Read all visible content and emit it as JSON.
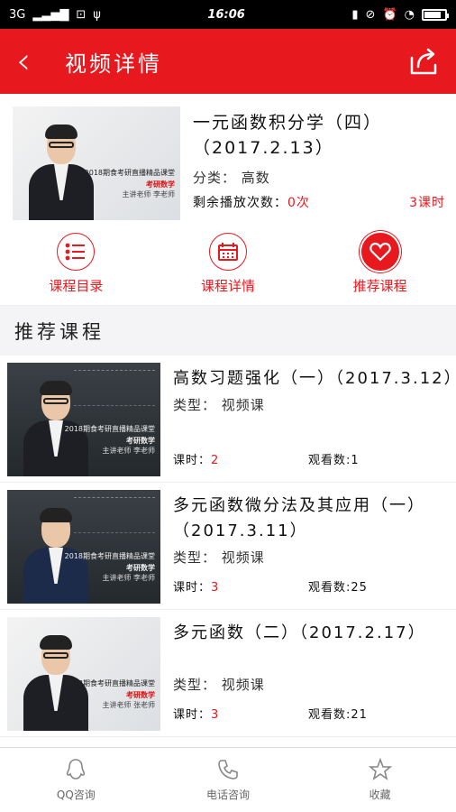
{
  "status_bar": {
    "network": "3G",
    "time": "16:06"
  },
  "appbar": {
    "title": "视频详情",
    "back_icon": "chevron-left-icon",
    "share_icon": "share-icon"
  },
  "course": {
    "title": "一元函数积分学（四）（2017.2.13）",
    "category": "分类：  高数",
    "remaining": "剩余播放次数：",
    "remaining_value": "0次",
    "hours": "3课时",
    "thumb": {
      "cap1": "2018期食考研直播精品课堂",
      "cap2": "考研数学",
      "cap3": "主讲老师 李老师"
    }
  },
  "actions": [
    {
      "label": "课程目录",
      "icon": "list-icon"
    },
    {
      "label": "课程详情",
      "icon": "calendar-icon"
    },
    {
      "label": "推荐课程",
      "icon": "heart-icon"
    }
  ],
  "section_title": "推荐课程",
  "recommended": [
    {
      "title": "高数习题强化（一）（2017.3.12）",
      "type": "类型：  视频课",
      "hours_label": "课时：",
      "hours_value": "2",
      "views": "观看数:1",
      "thumb": {
        "cap1": "2018期食考研直播精品课堂",
        "cap2": "考研数学",
        "cap3": "主讲老师 李老师"
      }
    },
    {
      "title": "多元函数微分法及其应用（一）（2017.3.11）",
      "type": "类型：  视频课",
      "hours_label": "课时：",
      "hours_value": "3",
      "views": "观看数:25",
      "thumb": {
        "cap1": "2018期食考研直播精品课堂",
        "cap2": "考研数学",
        "cap3": "主讲老师 李老师"
      }
    },
    {
      "title": "多元函数（二）（2017.2.17）",
      "type": "类型：  视频课",
      "hours_label": "课时：",
      "hours_value": "3",
      "views": "观看数:21",
      "thumb": {
        "cap1": "2018期食考研直播精品课堂",
        "cap2": "考研数学",
        "cap3": "主讲老师 张老师"
      }
    }
  ],
  "bottom_nav": [
    {
      "label": "QQ咨询",
      "icon": "qq-icon"
    },
    {
      "label": "电话咨询",
      "icon": "phone-icon"
    },
    {
      "label": "收藏",
      "icon": "star-icon"
    }
  ],
  "colors": {
    "accent": "#e8181f"
  }
}
